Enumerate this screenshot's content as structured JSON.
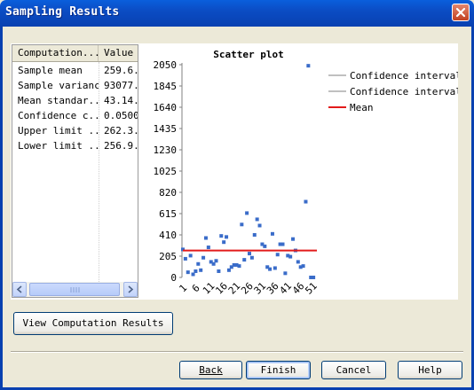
{
  "window": {
    "title": "Sampling Results"
  },
  "table": {
    "headers": [
      "Computation...",
      "Value"
    ],
    "rows": [
      [
        "Sample mean",
        "259.6."
      ],
      [
        "Sample variance",
        "93077."
      ],
      [
        "Mean standar...",
        "43.14."
      ],
      [
        "Confidence c...",
        "0.0500"
      ],
      [
        "Upper limit ...",
        "262.3."
      ],
      [
        "Lower limit ...",
        "256.9."
      ]
    ]
  },
  "buttons": {
    "view_results": "View Computation Results",
    "back": "Back",
    "finish": "Finish",
    "cancel": "Cancel",
    "help": "Help"
  },
  "chart_data": {
    "type": "scatter",
    "title": "Scatter plot",
    "ylim": [
      0,
      2050
    ],
    "y_ticks": [
      2050,
      1845,
      1640,
      1435,
      1230,
      1025,
      820,
      615,
      410,
      205,
      0
    ],
    "x_tick_labels": [
      "1",
      "6",
      "11",
      "16",
      "21",
      "26",
      "31",
      "36",
      "41",
      "46",
      "51"
    ],
    "xlim": [
      1,
      53
    ],
    "legend": [
      "Confidence interval",
      "Confidence interval",
      "Mean"
    ],
    "legend_position": "top-right",
    "colors": {
      "points": "#3a6cc9",
      "mean": "#e21b1b",
      "confidence": "#c0c0c0"
    },
    "mean": 259.6,
    "upper_limit": 262.3,
    "lower_limit": 256.9,
    "series": [
      {
        "x": [
          1,
          2,
          3,
          4,
          5,
          6,
          7,
          8,
          9,
          10,
          11,
          12,
          13,
          14,
          15,
          16,
          17,
          18,
          19,
          20,
          21,
          22,
          23,
          24,
          25,
          26,
          27,
          28,
          29,
          30,
          31,
          32,
          33,
          34,
          35,
          36,
          37,
          38,
          39,
          40,
          41,
          42,
          43,
          44,
          45,
          46,
          47,
          48,
          49,
          50,
          51,
          52
        ],
        "y": [
          270,
          180,
          50,
          210,
          30,
          60,
          130,
          70,
          190,
          380,
          290,
          150,
          130,
          160,
          60,
          400,
          340,
          390,
          70,
          100,
          120,
          120,
          110,
          510,
          170,
          620,
          230,
          190,
          410,
          560,
          500,
          320,
          300,
          100,
          80,
          420,
          90,
          220,
          320,
          320,
          40,
          210,
          200,
          370,
          260,
          150,
          100,
          110,
          730,
          2040,
          0,
          0
        ]
      }
    ]
  }
}
